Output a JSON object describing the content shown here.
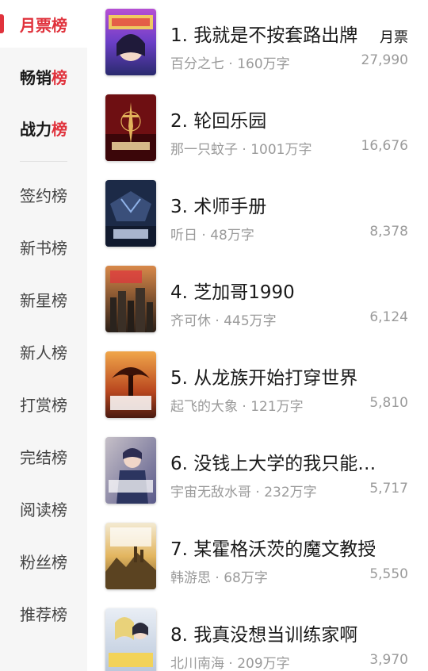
{
  "sidebar": {
    "items": [
      {
        "label_main": "月票",
        "label_tail": "榜"
      },
      {
        "label_main": "畅销",
        "label_tail": "榜"
      },
      {
        "label_main": "战力",
        "label_tail": "榜"
      },
      {
        "label": "签约榜"
      },
      {
        "label": "新书榜"
      },
      {
        "label": "新星榜"
      },
      {
        "label": "新人榜"
      },
      {
        "label": "打赏榜"
      },
      {
        "label": "完结榜"
      },
      {
        "label": "阅读榜"
      },
      {
        "label": "粉丝榜"
      },
      {
        "label": "推荐榜"
      }
    ]
  },
  "list": {
    "badge": "月票",
    "books": [
      {
        "title": "1. 我就是不按套路出牌",
        "meta": "百分之七 · 160万字",
        "count": "27,990"
      },
      {
        "title": "2. 轮回乐园",
        "meta": "那一只蚊子 · 1001万字",
        "count": "16,676"
      },
      {
        "title": "3. 术师手册",
        "meta": "听日 · 48万字",
        "count": "8,378"
      },
      {
        "title": "4. 芝加哥1990",
        "meta": "齐可休 · 445万字",
        "count": "6,124"
      },
      {
        "title": "5. 从龙族开始打穿世界",
        "meta": "起飞的大象 · 121万字",
        "count": "5,810"
      },
      {
        "title": "6. 没钱上大学的我只能…",
        "meta": "宇宙无敌水哥 · 232万字",
        "count": "5,717"
      },
      {
        "title": "7. 某霍格沃茨的魔文教授",
        "meta": "韩游思 · 68万字",
        "count": "5,550"
      },
      {
        "title": "8. 我真没想当训练家啊",
        "meta": "北川南海 · 209万字",
        "count": "3,970"
      }
    ]
  }
}
